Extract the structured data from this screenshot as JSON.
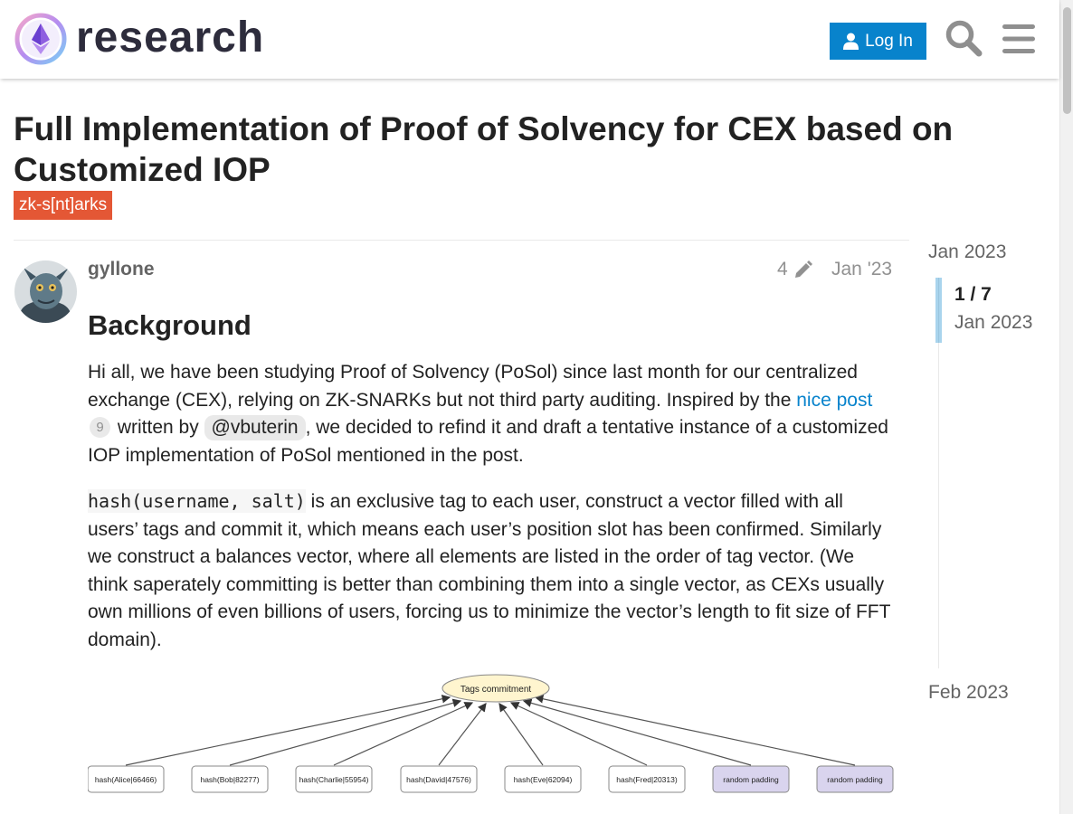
{
  "header": {
    "logo_text": "research",
    "login_label": "Log In"
  },
  "topic": {
    "title": "Full Implementation of Proof of Solvency for CEX based on Customized IOP",
    "tag": "zk-s[nt]arks"
  },
  "post": {
    "username": "gyllone",
    "edit_count": "4",
    "date": "Jan '23",
    "heading": "Background",
    "p1_a": "Hi all, we have been studying Proof of Solvency (PoSol) since last month for our centralized exchange (CEX), relying on ZK-SNARKs but not third party auditing. Inspired by the ",
    "p1_link": "nice post",
    "p1_badge": "9",
    "p1_b": " written by ",
    "p1_mention": "@vbuterin",
    "p1_c": ", we decided to refind it and draft a tentative instance of a customized IOP implementation of PoSol mentioned in the post.",
    "p2_code": "hash(username, salt)",
    "p2_text": " is an exclusive tag to each user, construct a vector filled with all users’ tags and commit it, which means each user’s position slot has been confirmed. Similarly we construct a balances vector, where all elements are listed in the order of tag vector. (We think saperately committing is better than combining them into a single vector, as CEXs usually own millions of even billions of users, forcing us to minimize the vector’s length to fit size of FFT domain)."
  },
  "diagram": {
    "root": "Tags commitment",
    "nodes": [
      "hash(Alice|66466)",
      "hash(Bob|82277)",
      "hash(Charlie|55954)",
      "hash(David|47576)",
      "hash(Eve|62094)",
      "hash(Fred|20313)",
      "random padding",
      "random padding"
    ]
  },
  "timeline": {
    "start": "Jan 2023",
    "position": "1 / 7",
    "position_date": "Jan 2023",
    "end": "Feb 2023"
  }
}
